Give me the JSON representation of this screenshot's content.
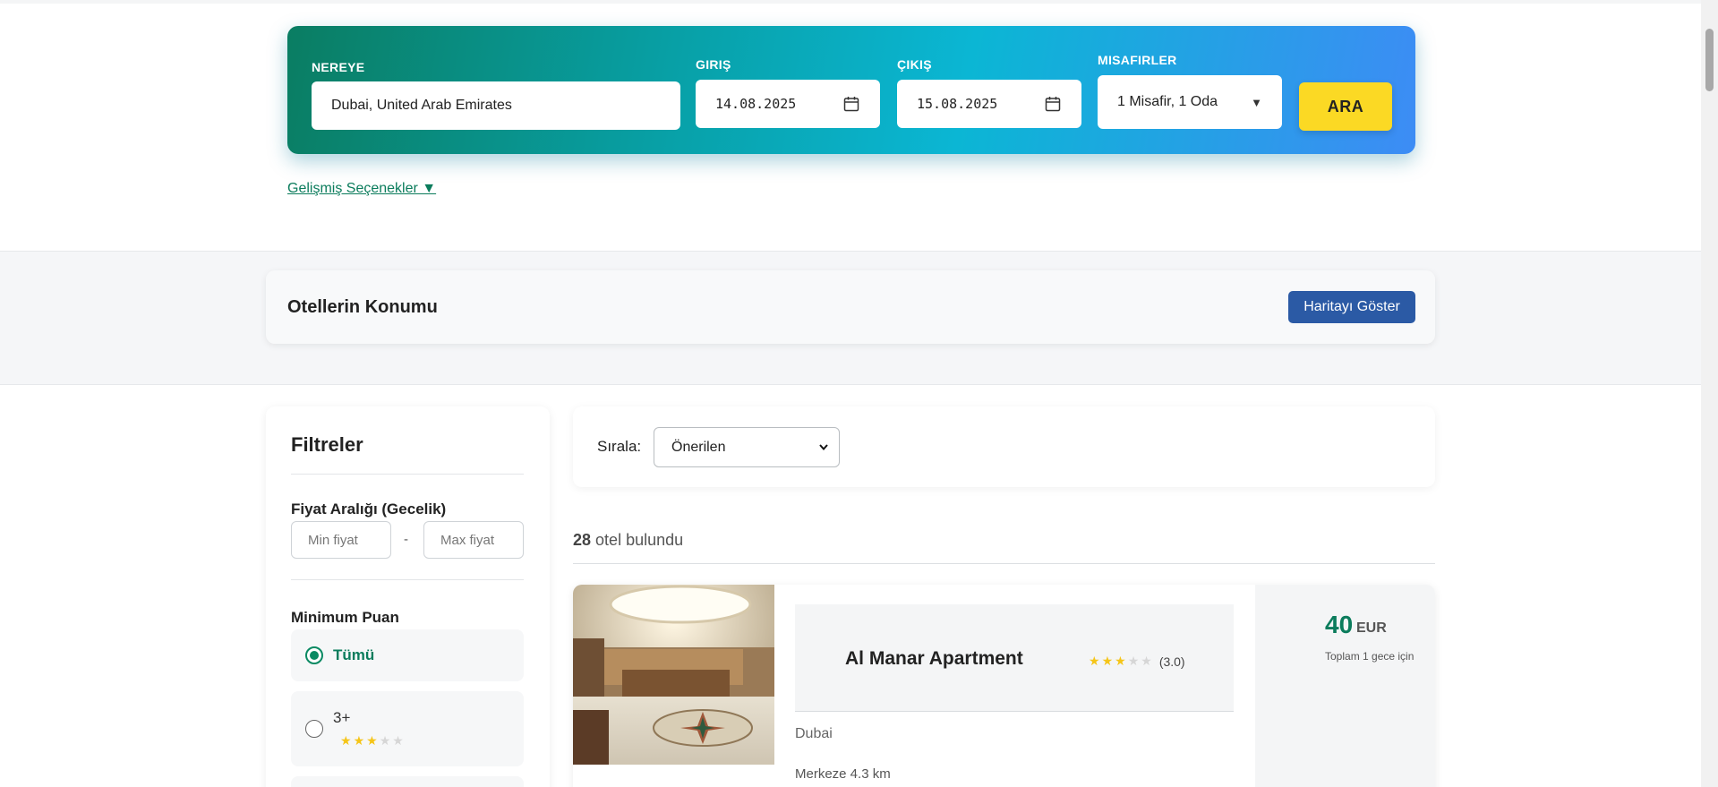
{
  "search": {
    "where_label": "NEREYE",
    "where_value": "Dubai, United Arab Emirates",
    "checkin_label": "GIRIŞ",
    "checkin_value": "14.08.2025",
    "checkout_label": "ÇIKIŞ",
    "checkout_value": "15.08.2025",
    "guests_label": "MISAFIRLER",
    "guests_value": "1 Misafir, 1 Oda",
    "search_button": "ARA",
    "advanced_link": "Gelişmiş Seçenekler ▼"
  },
  "location": {
    "title": "Otellerin Konumu",
    "map_button": "Haritayı Göster"
  },
  "filters": {
    "title": "Filtreler",
    "price_title": "Fiyat Aralığı (Gecelik)",
    "min_placeholder": "Min fiyat",
    "max_placeholder": "Max fiyat",
    "price_separator": "-",
    "rating_title": "Minimum Puan",
    "rating_options": [
      {
        "label": "Tümü",
        "selected": true
      },
      {
        "label": "3+",
        "stars": 3,
        "selected": false
      }
    ]
  },
  "sort": {
    "label": "Sırala:",
    "selected": "Önerilen"
  },
  "results": {
    "count": "28",
    "count_text": "otel bulundu"
  },
  "hotels": [
    {
      "name": "Al Manar Apartment",
      "stars": 3,
      "rating_text": "(3.0)",
      "city": "Dubai",
      "distance": "Merkeze 4.3 km",
      "price": "40",
      "currency": "EUR",
      "price_note": "Toplam 1 gece için"
    }
  ],
  "colors": {
    "brand_green": "#0b7c5c",
    "search_button": "#fbd924",
    "map_button": "#2b5aa5",
    "star": "#f5c518"
  }
}
